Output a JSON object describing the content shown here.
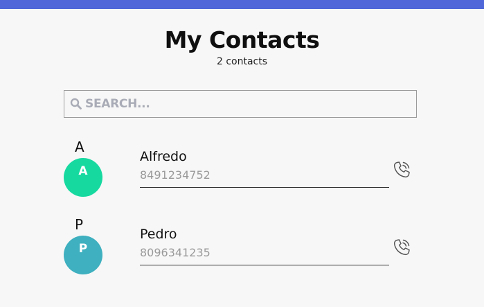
{
  "header": {
    "title": "My Contacts",
    "subtitle": "2 contacts"
  },
  "search": {
    "placeholder": "SEARCH...",
    "value": ""
  },
  "colors": {
    "topbar": "#4f67d9",
    "avatar_a": "#16d9a0",
    "avatar_p": "#3eb0bf"
  },
  "contacts": [
    {
      "group_letter": "A",
      "initial": "A",
      "name": "Alfredo",
      "phone": "8491234752",
      "avatar_color": "#16d9a0",
      "icon": "phone-call-icon"
    },
    {
      "group_letter": "P",
      "initial": "P",
      "name": "Pedro",
      "phone": "8096341235",
      "avatar_color": "#3eb0bf",
      "icon": "phone-call-icon"
    }
  ]
}
